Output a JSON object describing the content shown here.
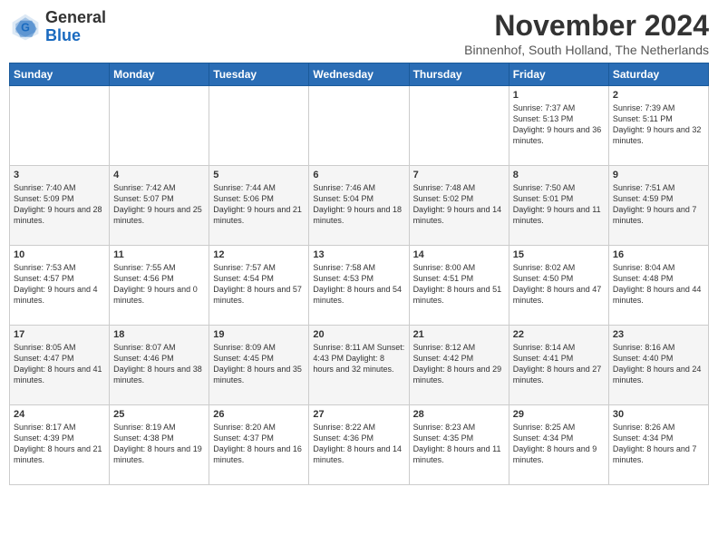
{
  "header": {
    "logo_general": "General",
    "logo_blue": "Blue",
    "month_title": "November 2024",
    "location": "Binnenhof, South Holland, The Netherlands"
  },
  "columns": [
    "Sunday",
    "Monday",
    "Tuesday",
    "Wednesday",
    "Thursday",
    "Friday",
    "Saturday"
  ],
  "weeks": [
    [
      {
        "day": "",
        "info": ""
      },
      {
        "day": "",
        "info": ""
      },
      {
        "day": "",
        "info": ""
      },
      {
        "day": "",
        "info": ""
      },
      {
        "day": "",
        "info": ""
      },
      {
        "day": "1",
        "info": "Sunrise: 7:37 AM\nSunset: 5:13 PM\nDaylight: 9 hours and 36 minutes."
      },
      {
        "day": "2",
        "info": "Sunrise: 7:39 AM\nSunset: 5:11 PM\nDaylight: 9 hours and 32 minutes."
      }
    ],
    [
      {
        "day": "3",
        "info": "Sunrise: 7:40 AM\nSunset: 5:09 PM\nDaylight: 9 hours and 28 minutes."
      },
      {
        "day": "4",
        "info": "Sunrise: 7:42 AM\nSunset: 5:07 PM\nDaylight: 9 hours and 25 minutes."
      },
      {
        "day": "5",
        "info": "Sunrise: 7:44 AM\nSunset: 5:06 PM\nDaylight: 9 hours and 21 minutes."
      },
      {
        "day": "6",
        "info": "Sunrise: 7:46 AM\nSunset: 5:04 PM\nDaylight: 9 hours and 18 minutes."
      },
      {
        "day": "7",
        "info": "Sunrise: 7:48 AM\nSunset: 5:02 PM\nDaylight: 9 hours and 14 minutes."
      },
      {
        "day": "8",
        "info": "Sunrise: 7:50 AM\nSunset: 5:01 PM\nDaylight: 9 hours and 11 minutes."
      },
      {
        "day": "9",
        "info": "Sunrise: 7:51 AM\nSunset: 4:59 PM\nDaylight: 9 hours and 7 minutes."
      }
    ],
    [
      {
        "day": "10",
        "info": "Sunrise: 7:53 AM\nSunset: 4:57 PM\nDaylight: 9 hours and 4 minutes."
      },
      {
        "day": "11",
        "info": "Sunrise: 7:55 AM\nSunset: 4:56 PM\nDaylight: 9 hours and 0 minutes."
      },
      {
        "day": "12",
        "info": "Sunrise: 7:57 AM\nSunset: 4:54 PM\nDaylight: 8 hours and 57 minutes."
      },
      {
        "day": "13",
        "info": "Sunrise: 7:58 AM\nSunset: 4:53 PM\nDaylight: 8 hours and 54 minutes."
      },
      {
        "day": "14",
        "info": "Sunrise: 8:00 AM\nSunset: 4:51 PM\nDaylight: 8 hours and 51 minutes."
      },
      {
        "day": "15",
        "info": "Sunrise: 8:02 AM\nSunset: 4:50 PM\nDaylight: 8 hours and 47 minutes."
      },
      {
        "day": "16",
        "info": "Sunrise: 8:04 AM\nSunset: 4:48 PM\nDaylight: 8 hours and 44 minutes."
      }
    ],
    [
      {
        "day": "17",
        "info": "Sunrise: 8:05 AM\nSunset: 4:47 PM\nDaylight: 8 hours and 41 minutes."
      },
      {
        "day": "18",
        "info": "Sunrise: 8:07 AM\nSunset: 4:46 PM\nDaylight: 8 hours and 38 minutes."
      },
      {
        "day": "19",
        "info": "Sunrise: 8:09 AM\nSunset: 4:45 PM\nDaylight: 8 hours and 35 minutes."
      },
      {
        "day": "20",
        "info": "Sunrise: 8:11 AM\nSunset: 4:43 PM\nDaylight: 8 hours and 32 minutes."
      },
      {
        "day": "21",
        "info": "Sunrise: 8:12 AM\nSunset: 4:42 PM\nDaylight: 8 hours and 29 minutes."
      },
      {
        "day": "22",
        "info": "Sunrise: 8:14 AM\nSunset: 4:41 PM\nDaylight: 8 hours and 27 minutes."
      },
      {
        "day": "23",
        "info": "Sunrise: 8:16 AM\nSunset: 4:40 PM\nDaylight: 8 hours and 24 minutes."
      }
    ],
    [
      {
        "day": "24",
        "info": "Sunrise: 8:17 AM\nSunset: 4:39 PM\nDaylight: 8 hours and 21 minutes."
      },
      {
        "day": "25",
        "info": "Sunrise: 8:19 AM\nSunset: 4:38 PM\nDaylight: 8 hours and 19 minutes."
      },
      {
        "day": "26",
        "info": "Sunrise: 8:20 AM\nSunset: 4:37 PM\nDaylight: 8 hours and 16 minutes."
      },
      {
        "day": "27",
        "info": "Sunrise: 8:22 AM\nSunset: 4:36 PM\nDaylight: 8 hours and 14 minutes."
      },
      {
        "day": "28",
        "info": "Sunrise: 8:23 AM\nSunset: 4:35 PM\nDaylight: 8 hours and 11 minutes."
      },
      {
        "day": "29",
        "info": "Sunrise: 8:25 AM\nSunset: 4:34 PM\nDaylight: 8 hours and 9 minutes."
      },
      {
        "day": "30",
        "info": "Sunrise: 8:26 AM\nSunset: 4:34 PM\nDaylight: 8 hours and 7 minutes."
      }
    ]
  ]
}
